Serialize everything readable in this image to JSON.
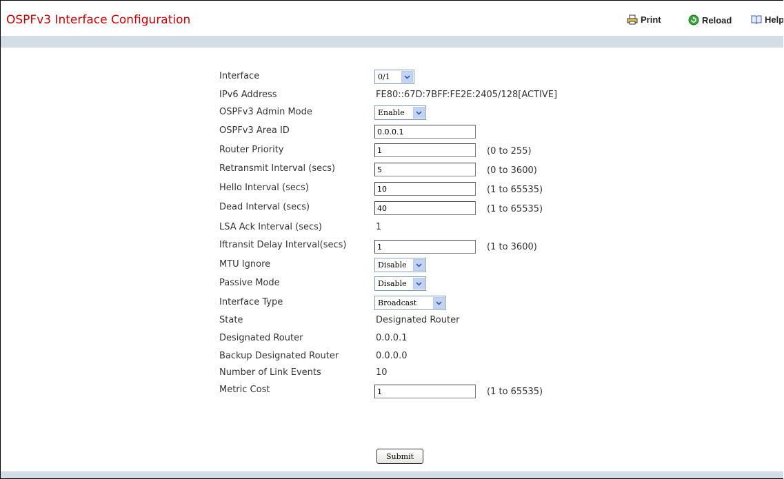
{
  "header": {
    "title": "OSPFv3 Interface Configuration",
    "print_label": "Print",
    "reload_label": "Reload",
    "help_label": "Help"
  },
  "form": {
    "interface": {
      "label": "Interface",
      "value": "0/1"
    },
    "ipv6_address": {
      "label": "IPv6 Address",
      "value": "FE80::67D:7BFF:FE2E:2405/128[ACTIVE]"
    },
    "admin_mode": {
      "label": "OSPFv3 Admin Mode",
      "value": "Enable"
    },
    "area_id": {
      "label": "OSPFv3 Area ID",
      "value": "0.0.0.1"
    },
    "router_priority": {
      "label": "Router Priority",
      "value": "1",
      "range": "(0 to 255)"
    },
    "retransmit_interval": {
      "label": "Retransmit Interval (secs)",
      "value": "5",
      "range": "(0 to 3600)"
    },
    "hello_interval": {
      "label": "Hello Interval (secs)",
      "value": "10",
      "range": "(1 to 65535)"
    },
    "dead_interval": {
      "label": "Dead Interval (secs)",
      "value": "40",
      "range": "(1 to 65535)"
    },
    "lsa_ack_interval": {
      "label": "LSA Ack Interval (secs)",
      "value": "1"
    },
    "iftransit_delay": {
      "label": "Iftransit Delay Interval(secs)",
      "value": "1",
      "range": "(1 to 3600)"
    },
    "mtu_ignore": {
      "label": "MTU Ignore",
      "value": "Disable"
    },
    "passive_mode": {
      "label": "Passive Mode",
      "value": "Disable"
    },
    "interface_type": {
      "label": "Interface Type",
      "value": "Broadcast"
    },
    "state": {
      "label": "State",
      "value": "Designated Router"
    },
    "designated_router": {
      "label": "Designated Router",
      "value": "0.0.0.1"
    },
    "backup_designated_router": {
      "label": "Backup Designated Router",
      "value": "0.0.0.0"
    },
    "link_events": {
      "label": "Number of Link Events",
      "value": "10"
    },
    "metric_cost": {
      "label": "Metric Cost",
      "value": "1",
      "range": "(1 to 65535)"
    },
    "submit_label": "Submit"
  },
  "colors": {
    "title": "#cc0000",
    "bar": "#d2dde5",
    "select_button": "#c1d3fb"
  },
  "icons": {
    "print": "printer-icon",
    "reload": "reload-icon",
    "help": "book-icon",
    "dropdown": "chevron-down-icon"
  }
}
